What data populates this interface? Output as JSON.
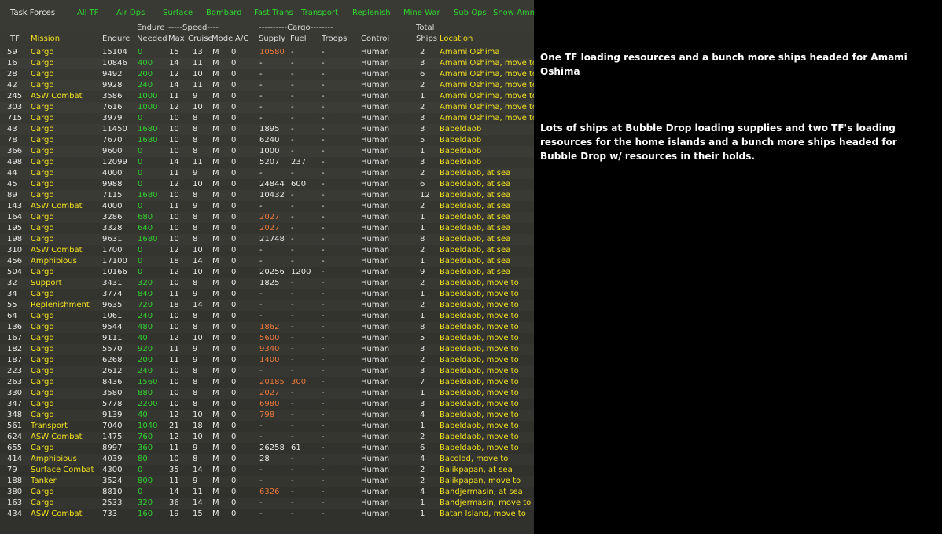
{
  "tabs": {
    "title": "Task Forces",
    "items": [
      "All TF",
      "Air Ops",
      "Surface",
      "Bombard",
      "Fast Trans",
      "Transport",
      "Replenish",
      "Mine War",
      "Sub Ops",
      "Show Amm"
    ]
  },
  "headers": {
    "endure_top": "Endure",
    "speed_group": "-----Speed----",
    "cargo_group": "----------Cargo--------",
    "total_top": "Total",
    "tf": "TF",
    "mission": "Mission",
    "endure": "Endure",
    "needed": "Needed",
    "max": "Max",
    "cruise": "Cruise",
    "mode": "Mode",
    "ac": "A/C",
    "supply": "Supply",
    "fuel": "Fuel",
    "troops": "Troops",
    "control": "Control",
    "ships": "Ships",
    "location": "Location"
  },
  "rows": [
    [
      "59",
      "Cargo",
      "15104",
      "0",
      "15",
      "13",
      "M",
      "0",
      "10580",
      "-",
      "-",
      "Human",
      "2",
      "Amami Oshima"
    ],
    [
      "16",
      "Cargo",
      "10846",
      "400",
      "14",
      "11",
      "M",
      "0",
      "-",
      "-",
      "-",
      "Human",
      "3",
      "Amami Oshima, move to"
    ],
    [
      "28",
      "Cargo",
      "9492",
      "200",
      "12",
      "10",
      "M",
      "0",
      "-",
      "-",
      "-",
      "Human",
      "6",
      "Amami Oshima, move to"
    ],
    [
      "42",
      "Cargo",
      "9928",
      "240",
      "14",
      "11",
      "M",
      "0",
      "-",
      "-",
      "-",
      "Human",
      "2",
      "Amami Oshima, move to"
    ],
    [
      "245",
      "ASW Combat",
      "3586",
      "1000",
      "11",
      "9",
      "M",
      "0",
      "-",
      "-",
      "-",
      "Human",
      "1",
      "Amami Oshima, move to"
    ],
    [
      "303",
      "Cargo",
      "7616",
      "1000",
      "12",
      "10",
      "M",
      "0",
      "-",
      "-",
      "-",
      "Human",
      "2",
      "Amami Oshima, move to"
    ],
    [
      "715",
      "Cargo",
      "3979",
      "0",
      "10",
      "8",
      "M",
      "0",
      "-",
      "-",
      "-",
      "Human",
      "3",
      "Amami Oshima, move to"
    ],
    [
      "43",
      "Cargo",
      "11450",
      "1680",
      "10",
      "8",
      "M",
      "0",
      "1895",
      "-",
      "-",
      "Human",
      "3",
      "Babeldaob"
    ],
    [
      "78",
      "Cargo",
      "7670",
      "1680",
      "10",
      "8",
      "M",
      "0",
      "6240",
      "-",
      "-",
      "Human",
      "5",
      "Babeldaob"
    ],
    [
      "366",
      "Cargo",
      "9600",
      "0",
      "10",
      "8",
      "M",
      "0",
      "1000",
      "-",
      "-",
      "Human",
      "1",
      "Babeldaob"
    ],
    [
      "498",
      "Cargo",
      "12099",
      "0",
      "14",
      "11",
      "M",
      "0",
      "5207",
      "237",
      "-",
      "Human",
      "3",
      "Babeldaob"
    ],
    [
      "44",
      "Cargo",
      "4000",
      "0",
      "11",
      "9",
      "M",
      "0",
      "-",
      "-",
      "-",
      "Human",
      "2",
      "Babeldaob, at sea"
    ],
    [
      "45",
      "Cargo",
      "9988",
      "0",
      "12",
      "10",
      "M",
      "0",
      "24844",
      "600",
      "-",
      "Human",
      "6",
      "Babeldaob, at sea"
    ],
    [
      "89",
      "Cargo",
      "7115",
      "1680",
      "10",
      "8",
      "M",
      "0",
      "10432",
      "-",
      "-",
      "Human",
      "12",
      "Babeldaob, at sea"
    ],
    [
      "143",
      "ASW Combat",
      "4000",
      "0",
      "11",
      "9",
      "M",
      "0",
      "-",
      "-",
      "-",
      "Human",
      "2",
      "Babeldaob, at sea"
    ],
    [
      "164",
      "Cargo",
      "3286",
      "680",
      "10",
      "8",
      "M",
      "0",
      "2027",
      "-",
      "-",
      "Human",
      "1",
      "Babeldaob, at sea"
    ],
    [
      "195",
      "Cargo",
      "3328",
      "640",
      "10",
      "8",
      "M",
      "0",
      "2027",
      "-",
      "-",
      "Human",
      "1",
      "Babeldaob, at sea"
    ],
    [
      "198",
      "Cargo",
      "9631",
      "1680",
      "10",
      "8",
      "M",
      "0",
      "21748",
      "-",
      "-",
      "Human",
      "8",
      "Babeldaob, at sea"
    ],
    [
      "310",
      "ASW Combat",
      "1700",
      "0",
      "12",
      "10",
      "M",
      "0",
      "-",
      "-",
      "-",
      "Human",
      "2",
      "Babeldaob, at sea"
    ],
    [
      "456",
      "Amphibious",
      "17100",
      "0",
      "18",
      "14",
      "M",
      "0",
      "-",
      "-",
      "-",
      "Human",
      "1",
      "Babeldaob, at sea"
    ],
    [
      "504",
      "Cargo",
      "10166",
      "0",
      "12",
      "10",
      "M",
      "0",
      "20256",
      "1200",
      "-",
      "Human",
      "9",
      "Babeldaob, at sea"
    ],
    [
      "32",
      "Support",
      "3431",
      "320",
      "10",
      "8",
      "M",
      "0",
      "1825",
      "-",
      "-",
      "Human",
      "2",
      "Babeldaob, move to"
    ],
    [
      "34",
      "Cargo",
      "3774",
      "840",
      "11",
      "9",
      "M",
      "0",
      "-",
      "-",
      "-",
      "Human",
      "1",
      "Babeldaob, move to"
    ],
    [
      "55",
      "Replenishment",
      "9635",
      "720",
      "18",
      "14",
      "M",
      "0",
      "-",
      "-",
      "-",
      "Human",
      "2",
      "Babeldaob, move to"
    ],
    [
      "64",
      "Cargo",
      "1061",
      "240",
      "10",
      "8",
      "M",
      "0",
      "-",
      "-",
      "-",
      "Human",
      "1",
      "Babeldaob, move to"
    ],
    [
      "136",
      "Cargo",
      "9544",
      "480",
      "10",
      "8",
      "M",
      "0",
      "1862",
      "-",
      "-",
      "Human",
      "8",
      "Babeldaob, move to"
    ],
    [
      "167",
      "Cargo",
      "9111",
      "40",
      "12",
      "10",
      "M",
      "0",
      "5600",
      "-",
      "-",
      "Human",
      "5",
      "Babeldaob, move to"
    ],
    [
      "182",
      "Cargo",
      "5570",
      "920",
      "11",
      "9",
      "M",
      "0",
      "9340",
      "-",
      "-",
      "Human",
      "3",
      "Babeldaob, move to"
    ],
    [
      "187",
      "Cargo",
      "6268",
      "200",
      "11",
      "9",
      "M",
      "0",
      "1400",
      "-",
      "-",
      "Human",
      "2",
      "Babeldaob, move to"
    ],
    [
      "223",
      "Cargo",
      "2612",
      "240",
      "10",
      "8",
      "M",
      "0",
      "-",
      "-",
      "-",
      "Human",
      "3",
      "Babeldaob, move to"
    ],
    [
      "263",
      "Cargo",
      "8436",
      "1560",
      "10",
      "8",
      "M",
      "0",
      "20185",
      "300",
      "-",
      "Human",
      "7",
      "Babeldaob, move to"
    ],
    [
      "330",
      "Cargo",
      "3580",
      "880",
      "10",
      "8",
      "M",
      "0",
      "2027",
      "-",
      "-",
      "Human",
      "1",
      "Babeldaob, move to"
    ],
    [
      "347",
      "Cargo",
      "5778",
      "2200",
      "10",
      "8",
      "M",
      "0",
      "6980",
      "-",
      "-",
      "Human",
      "3",
      "Babeldaob, move to"
    ],
    [
      "348",
      "Cargo",
      "9139",
      "40",
      "12",
      "10",
      "M",
      "0",
      "798",
      "-",
      "-",
      "Human",
      "4",
      "Babeldaob, move to"
    ],
    [
      "561",
      "Transport",
      "7040",
      "1040",
      "21",
      "18",
      "M",
      "0",
      "-",
      "-",
      "-",
      "Human",
      "1",
      "Babeldaob, move to"
    ],
    [
      "624",
      "ASW Combat",
      "1475",
      "760",
      "12",
      "10",
      "M",
      "0",
      "-",
      "-",
      "-",
      "Human",
      "2",
      "Babeldaob, move to"
    ],
    [
      "655",
      "Cargo",
      "8997",
      "360",
      "11",
      "9",
      "M",
      "0",
      "26258",
      "61",
      "-",
      "Human",
      "6",
      "Babeldaob, move to"
    ],
    [
      "414",
      "Amphibious",
      "4039",
      "80",
      "10",
      "8",
      "M",
      "0",
      "28",
      "-",
      "-",
      "Human",
      "4",
      "Bacolod, move to"
    ],
    [
      "79",
      "Surface Combat",
      "4300",
      "0",
      "35",
      "14",
      "M",
      "0",
      "-",
      "-",
      "-",
      "Human",
      "2",
      "Balikpapan, at sea"
    ],
    [
      "188",
      "Tanker",
      "3524",
      "800",
      "11",
      "9",
      "M",
      "0",
      "-",
      "-",
      "-",
      "Human",
      "2",
      "Balikpapan, move to"
    ],
    [
      "380",
      "Cargo",
      "8810",
      "0",
      "14",
      "11",
      "M",
      "0",
      "6326",
      "-",
      "-",
      "Human",
      "4",
      "Bandjermasin, at sea"
    ],
    [
      "163",
      "Cargo",
      "2533",
      "320",
      "36",
      "14",
      "M",
      "0",
      "-",
      "-",
      "-",
      "Human",
      "1",
      "Bandjermasin, move to"
    ],
    [
      "434",
      "ASW Combat",
      "733",
      "160",
      "19",
      "15",
      "M",
      "0",
      "-",
      "-",
      "-",
      "Human",
      "1",
      "Batan Island, move to"
    ]
  ],
  "orange_supply_rows": [
    0,
    15,
    16,
    25,
    26,
    27,
    28,
    30,
    31,
    32,
    33,
    40
  ],
  "orange_fuel_rows": [
    30
  ],
  "notes": [
    "One TF loading resources and a bunch more ships headed for Amami Oshima",
    "Lots of ships at Bubble Drop loading supplies and two TF's loading resources for the home islands and a bunch more ships headed for Bubble Drop w/ resources in their holds."
  ],
  "colors": {
    "accent_green": "#30d030",
    "text_yellow": "#f0e020",
    "resource_orange": "#e8783c"
  }
}
